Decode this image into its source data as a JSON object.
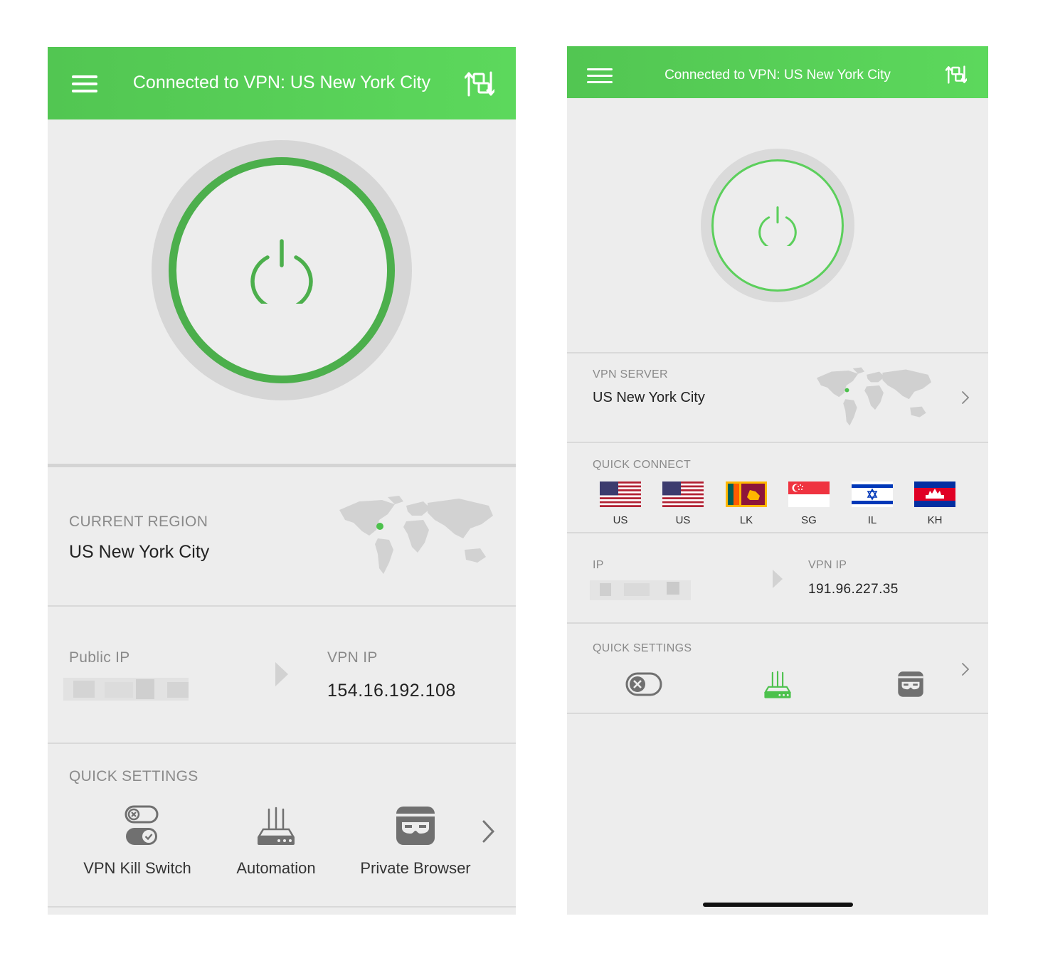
{
  "left": {
    "header": {
      "title": "Connected to VPN: US New York City"
    },
    "region": {
      "label": "CURRENT REGION",
      "value": "US New York City"
    },
    "ip": {
      "public_label": "Public IP",
      "vpn_label": "VPN IP",
      "vpn_value": "154.16.192.108"
    },
    "quick_settings": {
      "label": "QUICK SETTINGS",
      "items": [
        {
          "label": "VPN Kill Switch",
          "icon": "kill-switch-icon"
        },
        {
          "label": "Automation",
          "icon": "router-icon"
        },
        {
          "label": "Private Browser",
          "icon": "incognito-icon"
        }
      ]
    }
  },
  "right": {
    "header": {
      "title": "Connected to VPN: US New York City"
    },
    "server": {
      "label": "VPN SERVER",
      "value": "US New York City"
    },
    "quick_connect": {
      "label": "QUICK CONNECT",
      "flags": [
        {
          "code": "US"
        },
        {
          "code": "US"
        },
        {
          "code": "LK"
        },
        {
          "code": "SG"
        },
        {
          "code": "IL"
        },
        {
          "code": "KH"
        }
      ]
    },
    "ip": {
      "public_label": "IP",
      "vpn_label": "VPN IP",
      "vpn_value": "191.96.227.35"
    },
    "quick_settings": {
      "label": "QUICK SETTINGS"
    }
  },
  "colors": {
    "brand_green": "#5ccf5c",
    "power_green": "#4caf4c",
    "background": "#ededed"
  }
}
